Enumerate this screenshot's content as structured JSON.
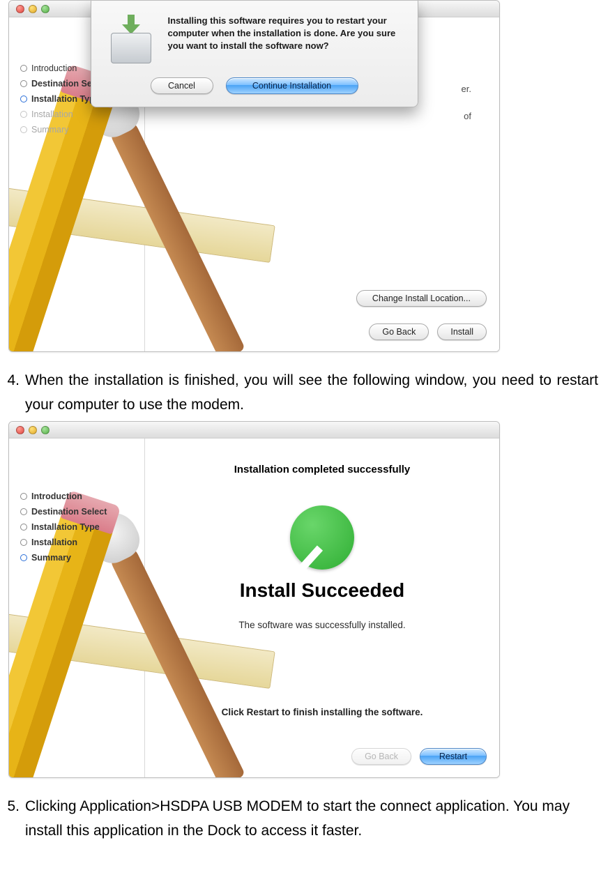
{
  "window1": {
    "sidebar": [
      {
        "label": "Introduction",
        "bold": false,
        "state": "done"
      },
      {
        "label": "Destination Select",
        "bold": true,
        "state": "done"
      },
      {
        "label": "Installation Type",
        "bold": true,
        "state": "active"
      },
      {
        "label": "Installation",
        "bold": false,
        "state": "dim"
      },
      {
        "label": "Summary",
        "bold": false,
        "state": "dim"
      }
    ],
    "partial_text_right_1": "er.",
    "partial_text_right_2": "of",
    "change_location_btn": "Change Install Location...",
    "go_back_btn": "Go Back",
    "install_btn": "Install",
    "sheet": {
      "message": "Installing this software requires you to restart your computer when the installation is done. Are you sure you want to install the software now?",
      "cancel": "Cancel",
      "continue": "Continue Installation"
    }
  },
  "step4": {
    "num": "4.",
    "text": "When the installation is finished, you will see the following window, you need to restart your computer to use the modem."
  },
  "window2": {
    "header": "Installation completed successfully",
    "sidebar": [
      {
        "label": "Introduction"
      },
      {
        "label": "Destination Select"
      },
      {
        "label": "Installation Type"
      },
      {
        "label": "Installation"
      },
      {
        "label": "Summary"
      }
    ],
    "big": "Install Succeeded",
    "sub": "The software was successfully installed.",
    "sub2": "Click Restart to finish installing the software.",
    "go_back_btn": "Go Back",
    "restart_btn": "Restart"
  },
  "step5": {
    "num": "5.",
    "text": "Clicking Application>HSDPA USB MODEM to start the connect application. You may install this application in the Dock to access it faster."
  }
}
